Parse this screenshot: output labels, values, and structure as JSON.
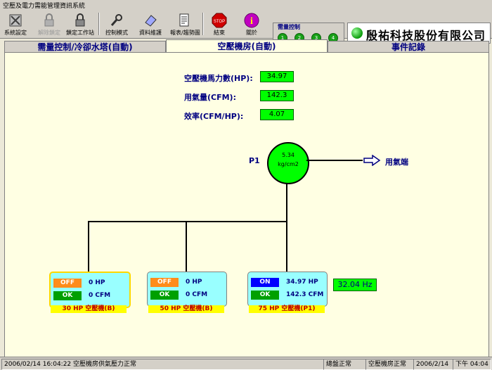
{
  "window": {
    "title": "空壓及電力需能管理資訊系統"
  },
  "toolbar": {
    "items": [
      {
        "label": "系統設定",
        "icon": "tools-icon"
      },
      {
        "label": "解除鎖定",
        "icon": "lock-icon"
      },
      {
        "label": "鎖定工作站",
        "icon": "lock-icon"
      },
      {
        "label": "控制模式",
        "icon": "wrench-icon"
      },
      {
        "label": "資料維護",
        "icon": "eraser-icon"
      },
      {
        "label": "報表/趨勢圖",
        "icon": "document-icon"
      },
      {
        "label": "結束",
        "icon": "stop-icon"
      },
      {
        "label": "關於",
        "icon": "info-icon"
      }
    ],
    "demand": {
      "title": "需量控制",
      "levels": [
        "1",
        "2",
        "3",
        "4"
      ]
    },
    "company": "殷祐科技股份有限公司"
  },
  "tabs": [
    {
      "label": "需量控制/冷卻水塔(自動)"
    },
    {
      "label": "空壓機房(自動)"
    },
    {
      "label": "事件記錄"
    }
  ],
  "metrics": [
    {
      "label": "空壓機馬力數(HP):",
      "value": "34.97"
    },
    {
      "label": "用氣量(CFM):",
      "value": "142.3"
    },
    {
      "label": "效率(CFM/HP):",
      "value": "4.07"
    }
  ],
  "header_tank": {
    "name": "P1",
    "value": "5.34",
    "unit": "kg/cm2",
    "destination": "用氣端"
  },
  "units": [
    {
      "state": "OFF",
      "hp": "0 HP",
      "ok": "OK",
      "cfm": "0 CFM",
      "label": "30 HP 空壓機(B)"
    },
    {
      "state": "OFF",
      "hp": "0 HP",
      "ok": "OK",
      "cfm": "0 CFM",
      "label": "50 HP 空壓機(B)"
    },
    {
      "state": "ON",
      "hp": "34.97 HP",
      "ok": "OK",
      "cfm": "142.3 CFM",
      "label": "75 HP 空壓機(P1)"
    }
  ],
  "frequency": "32.04   Hz",
  "status_bar": {
    "message": "2006/02/14 16:04:22 空壓機房供氣壓力正常",
    "s1": "總盤正常",
    "s2": "空壓機房正常",
    "date": "2006/2/14",
    "time": "下午 04:04"
  },
  "colors": {
    "panel": "#ffffe3",
    "on": "#0000ff",
    "off": "#ff8c1a",
    "ok": "#00a000",
    "value_bg": "#00ff00"
  }
}
